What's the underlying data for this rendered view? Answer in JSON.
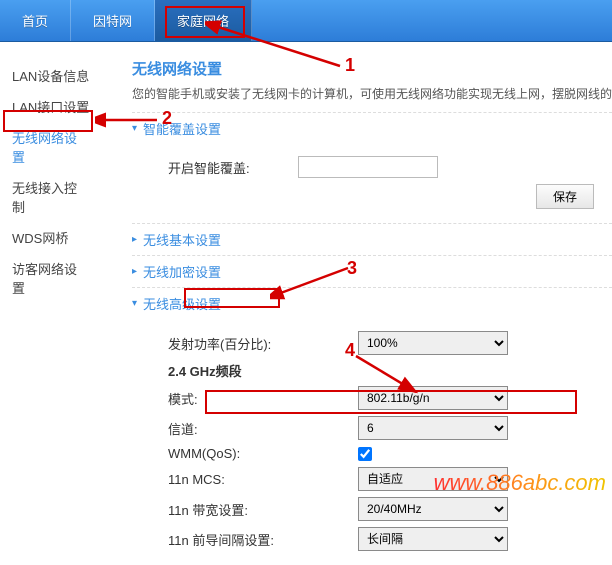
{
  "topnav": {
    "items": [
      {
        "label": "首页"
      },
      {
        "label": "因特网"
      },
      {
        "label": "家庭网络"
      }
    ],
    "active_index": 2
  },
  "sidebar": {
    "items": [
      {
        "label": "LAN设备信息"
      },
      {
        "label": "LAN接口设置"
      },
      {
        "label": "无线网络设置"
      },
      {
        "label": "无线接入控制"
      },
      {
        "label": "WDS网桥"
      },
      {
        "label": "访客网络设置"
      }
    ],
    "active_index": 2
  },
  "page": {
    "title": "无线网络设置",
    "hint": "您的智能手机或安装了无线网卡的计算机，可使用无线网络功能实现无线上网，摆脱网线的"
  },
  "sections": {
    "smart": {
      "title": "智能覆盖设置",
      "open": true,
      "enable_label": "开启智能覆盖:",
      "enable_value": "",
      "save_label": "保存"
    },
    "basic": {
      "title": "无线基本设置",
      "open": false
    },
    "enc": {
      "title": "无线加密设置",
      "open": false
    },
    "adv": {
      "title": "无线高级设置",
      "open": true,
      "fields": {
        "txpower_label": "发射功率(百分比):",
        "band_label": "2.4 GHz频段",
        "mode_label": "模式:",
        "channel_label": "信道:",
        "wmm_label": "WMM(QoS):",
        "mcs_label": "11n MCS:",
        "bw_label": "11n 带宽设置:",
        "gi_label": "11n 前导间隔设置:"
      },
      "values": {
        "txpower": "100%",
        "mode": "802.11b/g/n",
        "channel": "6",
        "wmm_checked": true,
        "mcs": "自适应",
        "bw": "20/40MHz",
        "gi": "长间隔"
      }
    }
  },
  "annotations": {
    "n1": "1",
    "n2": "2",
    "n3": "3",
    "n4": "4",
    "watermark": "www.886abc.com"
  }
}
